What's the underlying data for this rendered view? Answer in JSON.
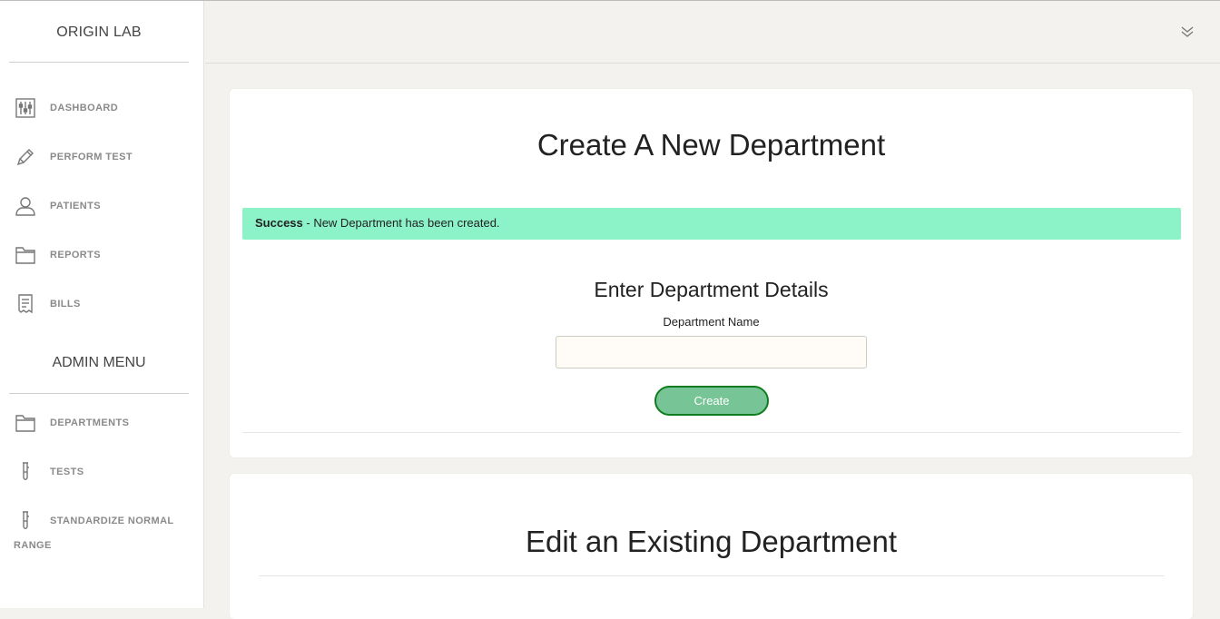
{
  "brand": "ORIGIN LAB",
  "sidebar": {
    "items": [
      {
        "label": "DASHBOARD",
        "icon": "sliders-icon"
      },
      {
        "label": "PERFORM TEST",
        "icon": "pencil-icon"
      },
      {
        "label": "PATIENTS",
        "icon": "user-icon"
      },
      {
        "label": "REPORTS",
        "icon": "folder-icon"
      },
      {
        "label": "BILLS",
        "icon": "receipt-icon"
      }
    ],
    "admin_title": "ADMIN MENU",
    "admin_items": [
      {
        "label": "DEPARTMENTS",
        "icon": "folder-icon"
      },
      {
        "label": "TESTS",
        "icon": "test-tube-icon"
      },
      {
        "label": "STANDARDIZE NORMAL",
        "icon": "test-tube-icon"
      }
    ],
    "admin_item_wrap": "RANGE"
  },
  "topbar": {
    "icon": "double-chevron-down-icon"
  },
  "create_card": {
    "title": "Create A New Department",
    "alert_strong": "Success",
    "alert_text": " - New Department has been created.",
    "subtitle": "Enter Department Details",
    "field_label": "Department Name",
    "field_value": "",
    "button_label": "Create"
  },
  "edit_card": {
    "title": "Edit an Existing Department"
  },
  "colors": {
    "alert_bg": "#8cf3c8",
    "button_bg": "#77c497",
    "button_border": "#0f7d1e"
  }
}
